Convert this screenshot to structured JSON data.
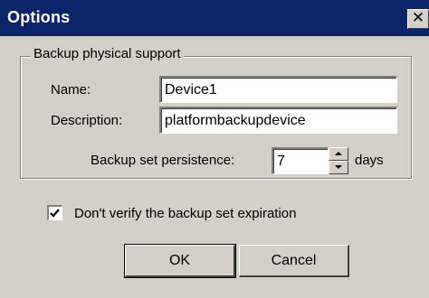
{
  "window": {
    "title": "Options",
    "close_glyph": "✕"
  },
  "group": {
    "legend": "Backup physical support"
  },
  "form": {
    "name_label": "Name:",
    "name_value": "Device1",
    "description_label": "Description:",
    "description_value": "platformbackupdevice",
    "persistence_label": "Backup set persistence:",
    "persistence_value": "7",
    "persistence_unit": "days"
  },
  "options": {
    "skip_expiration_label": "Don't verify the backup set expiration",
    "skip_expiration_checked": true
  },
  "buttons": {
    "ok_label": "OK",
    "cancel_label": "Cancel"
  },
  "colors": {
    "titlebar": "#0a246a",
    "face": "#d4d0c8"
  },
  "icons": {
    "close": "close-icon",
    "spin_up": "arrow-up-icon",
    "spin_down": "arrow-down-icon",
    "check": "checkmark-icon"
  }
}
